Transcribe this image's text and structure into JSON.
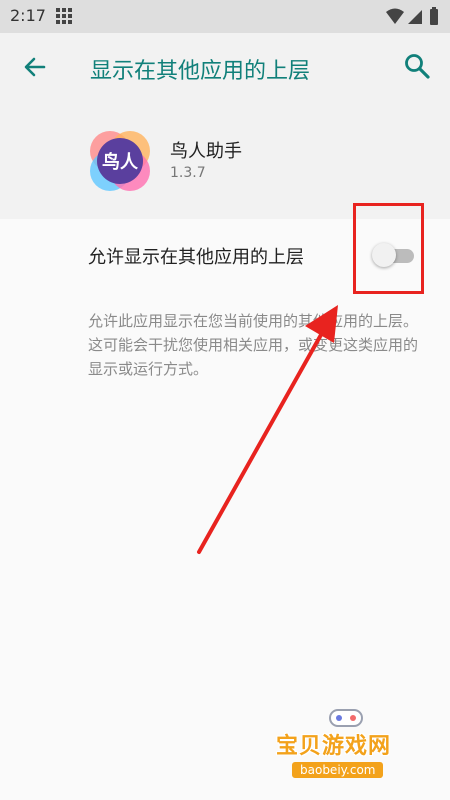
{
  "status_bar": {
    "time": "2:17"
  },
  "app_bar": {
    "title": "显示在其他应用的上层"
  },
  "app_info": {
    "name": "鸟人助手",
    "version": "1.3.7",
    "icon_text": "鸟人"
  },
  "preference": {
    "label": "允许显示在其他应用的上层",
    "enabled": false
  },
  "description": "允许此应用显示在您当前使用的其他应用的上层。这可能会干扰您使用相关应用，或变更这类应用的显示或运行方式。",
  "watermark": {
    "title": "宝贝游戏网",
    "url": "baobeiy.com"
  },
  "colors": {
    "accent": "#11807a",
    "highlight": "#e8231f",
    "watermark": "#f3a21b"
  }
}
